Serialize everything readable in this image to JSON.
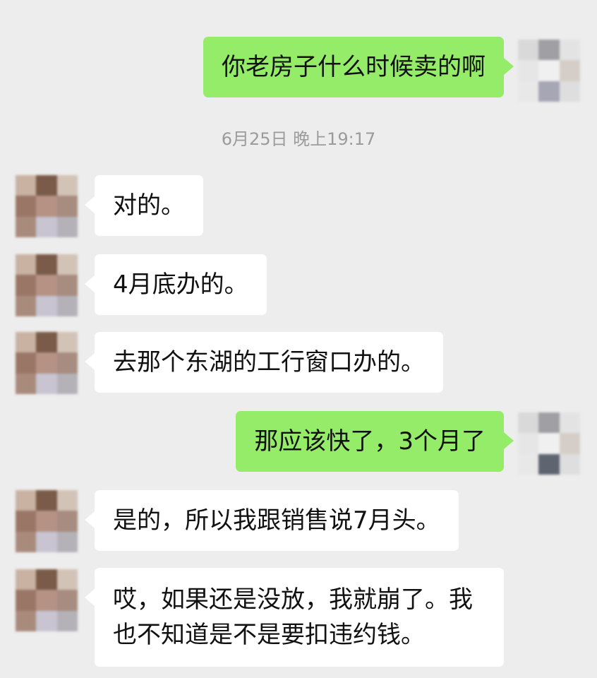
{
  "messages": [
    {
      "side": "out",
      "text": "你老房子什么时候卖的啊"
    },
    {
      "side": "in",
      "text": "对的。"
    },
    {
      "side": "in",
      "text": "4月底办的。"
    },
    {
      "side": "in",
      "text": "去那个东湖的工行窗口办的。"
    },
    {
      "side": "out",
      "text": "那应该快了，3个月了"
    },
    {
      "side": "in",
      "text": "是的，所以我跟销售说7月头。"
    },
    {
      "side": "in",
      "text": "哎，如果还是没放，我就崩了。我也不知道是不是要扣违约钱。"
    }
  ],
  "timestamp": "6月25日 晚上19:17",
  "colors": {
    "background": "#ededed",
    "outgoing_bubble": "#95ec69",
    "incoming_bubble": "#ffffff",
    "timestamp_text": "#9b9b9b"
  },
  "avatars": {
    "self": "avatar-icon (pixelated)",
    "contact": "avatar-icon (pixelated)"
  }
}
